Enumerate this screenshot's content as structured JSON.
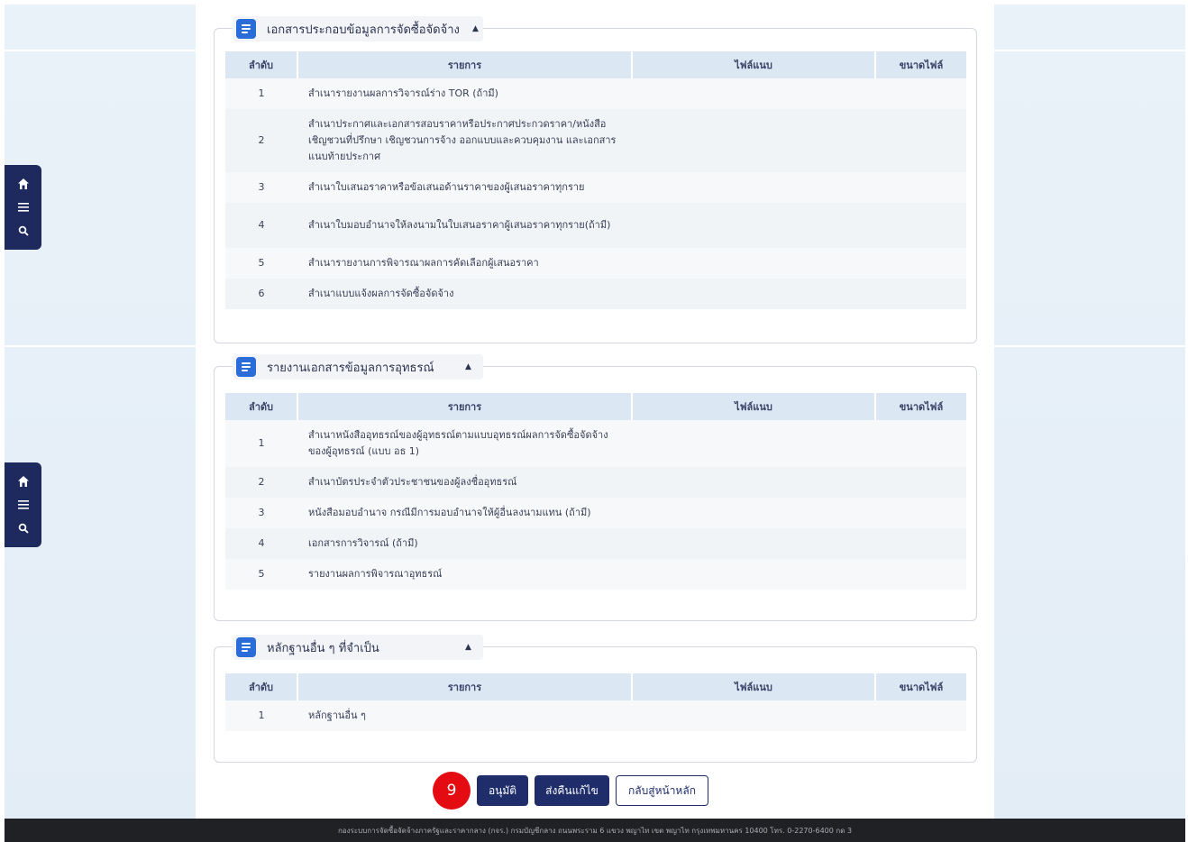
{
  "sidebar_tools": {
    "home_icon": "home-icon",
    "menu_icon": "menu-icon",
    "search_icon": "search-icon"
  },
  "columns": {
    "no": "ลำดับ",
    "item": "รายการ",
    "file": "ไฟล์แนบ",
    "size": "ขนาดไฟล์"
  },
  "sections": [
    {
      "title": "เอกสารประกอบข้อมูลการจัดซื้อจัดจ้าง",
      "rows": [
        {
          "no": "1",
          "item": "สำเนารายงานผลการวิจารณ์ร่าง TOR (ถ้ามี)"
        },
        {
          "no": "2",
          "item": "สำเนาประกาศและเอกสารสอบราคาหรือประกาศประกวดราคา/หนังสือเชิญชวนที่ปรึกษา เชิญชวนการจ้าง ออกแบบและควบคุมงาน และเอกสาร แนบท้ายประกาศ"
        },
        {
          "no": "3",
          "item": "สำเนาใบเสนอราคาหรือข้อเสนอด้านราคาของผู้เสนอราคาทุกราย"
        },
        {
          "no": "4",
          "item": "สำเนาใบมอบอำนาจให้ลงนามในใบเสนอราคาผู้เสนอราคาทุกราย(ถ้ามี)"
        },
        {
          "no": "5",
          "item": "สำเนารายงานการพิจารณาผลการคัดเลือกผู้เสนอราคา"
        },
        {
          "no": "6",
          "item": "สำเนาแบบแจ้งผลการจัดซื้อจัดจ้าง"
        }
      ]
    },
    {
      "title": "รายงานเอกสารข้อมูลการอุทธรณ์",
      "rows": [
        {
          "no": "1",
          "item": "สำเนาหนังสืออุทธรณ์ของผู้อุทธรณ์ตามแบบอุทธรณ์ผลการจัดซื้อจัดจ้างของผู้อุทธรณ์ (แบบ อธ 1)"
        },
        {
          "no": "2",
          "item": "สำเนาบัตรประจำตัวประชาชนของผู้ลงชื่ออุทธรณ์"
        },
        {
          "no": "3",
          "item": "หนังสือมอบอำนาจ กรณีมีการมอบอำนาจให้ผู้อื่นลงนามแทน (ถ้ามี)"
        },
        {
          "no": "4",
          "item": "เอกสารการวิจารณ์ (ถ้ามี)"
        },
        {
          "no": "5",
          "item": "รายงานผลการพิจารณาอุทธรณ์"
        }
      ]
    },
    {
      "title": "หลักฐานอื่น ๆ ที่จำเป็น",
      "rows": [
        {
          "no": "1",
          "item": "หลักฐานอื่น ๆ"
        }
      ]
    }
  ],
  "actions": {
    "step_number": "9",
    "approve": "อนุมัติ",
    "send_back": "ส่งคืนแก้ไข",
    "back_home": "กลับสู่หน้าหลัก"
  },
  "footer": "กองระบบการจัดซื้อจัดจ้างภาครัฐและราคากลาง (กจร.) กรมบัญชีกลาง ถนนพระราม 6 แขวง พญาไท เขต พญาไท กรุงเทพมหานคร 10400 โทร. 0-2270-6400 กด 3",
  "colors": {
    "navy": "#1f2d6b",
    "accent_blue": "#2a6cd8",
    "badge_red": "#e40b13",
    "header_blue": "#dbe7f2"
  }
}
